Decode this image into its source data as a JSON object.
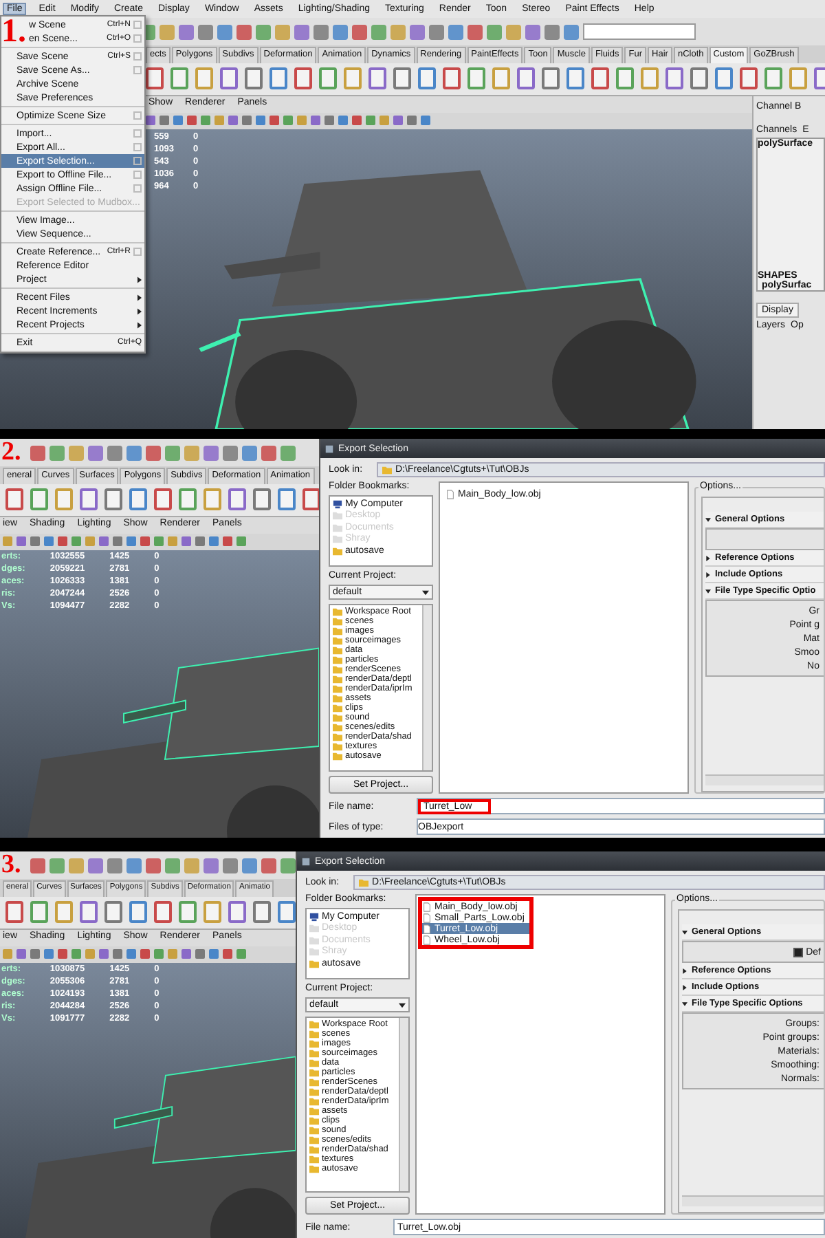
{
  "menu_step": {
    "number": "1.",
    "menubar": [
      {
        "label": "File",
        "selected": true
      },
      {
        "label": "Edit",
        "selected": false
      },
      {
        "label": "Modify",
        "selected": false
      },
      {
        "label": "Create",
        "selected": false
      },
      {
        "label": "Display",
        "selected": false
      },
      {
        "label": "Window",
        "selected": false
      },
      {
        "label": "Assets",
        "selected": false
      },
      {
        "label": "Lighting/Shading",
        "selected": false
      },
      {
        "label": "Texturing",
        "selected": false
      },
      {
        "label": "Render",
        "selected": false
      },
      {
        "label": "Toon",
        "selected": false
      },
      {
        "label": "Stereo",
        "selected": false
      },
      {
        "label": "Paint Effects",
        "selected": false
      },
      {
        "label": "Help",
        "selected": false
      }
    ],
    "shelf_tabs": [
      {
        "label": "ects",
        "selected": false
      },
      {
        "label": "Polygons",
        "selected": false
      },
      {
        "label": "Subdivs",
        "selected": false
      },
      {
        "label": "Deformation",
        "selected": false
      },
      {
        "label": "Animation",
        "selected": false
      },
      {
        "label": "Dynamics",
        "selected": false
      },
      {
        "label": "Rendering",
        "selected": false
      },
      {
        "label": "PaintEffects",
        "selected": false
      },
      {
        "label": "Toon",
        "selected": false
      },
      {
        "label": "Muscle",
        "selected": false
      },
      {
        "label": "Fluids",
        "selected": false
      },
      {
        "label": "Fur",
        "selected": false
      },
      {
        "label": "Hair",
        "selected": false
      },
      {
        "label": "nCloth",
        "selected": false
      },
      {
        "label": "Custom",
        "selected": true
      },
      {
        "label": "GoZBrush",
        "selected": false
      }
    ],
    "panel_menu": [
      "Show",
      "Renderer",
      "Panels"
    ],
    "stats": [
      [
        "559",
        "0"
      ],
      [
        "1093",
        "0"
      ],
      [
        "543",
        "0"
      ],
      [
        "1036",
        "0"
      ],
      [
        "964",
        "0"
      ]
    ],
    "channel_box": {
      "title": "Channel B",
      "tabs": [
        "Channels",
        "E"
      ],
      "object": "polySurface",
      "shapes_heading": "SHAPES",
      "shape": "polySurfac",
      "layer_tabs": [
        {
          "label": "Display",
          "selected": true
        }
      ],
      "layer_menu": [
        "Layers",
        "Op"
      ]
    },
    "file_menu": [
      [
        {
          "label": "w Scene",
          "shortcut": "Ctrl+N",
          "option_box": true,
          "kind": "command",
          "disabled": false,
          "selected": false
        },
        {
          "label": "en Scene...",
          "shortcut": "Ctrl+O",
          "option_box": true,
          "kind": "command",
          "disabled": false,
          "selected": false
        }
      ],
      [
        {
          "label": "Save Scene",
          "shortcut": "Ctrl+S",
          "option_box": true,
          "kind": "command",
          "disabled": false,
          "selected": false
        },
        {
          "label": "Save Scene As...",
          "option_box": true,
          "kind": "command",
          "disabled": false,
          "selected": false
        },
        {
          "label": "Archive Scene",
          "option_box": false,
          "kind": "command",
          "disabled": false,
          "selected": false
        },
        {
          "label": "Save Preferences",
          "option_box": false,
          "kind": "command",
          "disabled": false,
          "selected": false
        }
      ],
      [
        {
          "label": "Optimize Scene Size",
          "option_box": true,
          "kind": "command",
          "disabled": false,
          "selected": false
        }
      ],
      [
        {
          "label": "Import...",
          "option_box": true,
          "kind": "command",
          "disabled": false,
          "selected": false
        },
        {
          "label": "Export All...",
          "option_box": true,
          "kind": "command",
          "disabled": false,
          "selected": false
        },
        {
          "label": "Export Selection...",
          "option_box": true,
          "kind": "command",
          "disabled": false,
          "selected": true
        },
        {
          "label": "Export to Offline File...",
          "option_box": true,
          "kind": "command",
          "disabled": false,
          "selected": false
        },
        {
          "label": "Assign Offline File...",
          "option_box": true,
          "kind": "command",
          "disabled": false,
          "selected": false
        },
        {
          "label": "Export Selected to Mudbox...",
          "option_box": false,
          "kind": "command",
          "disabled": true,
          "selected": false
        }
      ],
      [
        {
          "label": "View Image...",
          "option_box": false,
          "kind": "command",
          "disabled": false,
          "selected": false
        },
        {
          "label": "View Sequence...",
          "option_box": false,
          "kind": "command",
          "disabled": false,
          "selected": false
        }
      ],
      [
        {
          "label": "Create Reference...",
          "shortcut": "Ctrl+R",
          "option_box": true,
          "kind": "command",
          "disabled": false,
          "selected": false
        },
        {
          "label": "Reference Editor",
          "option_box": false,
          "kind": "command",
          "disabled": false,
          "selected": false
        },
        {
          "label": "Project",
          "option_box": false,
          "kind": "submenu",
          "disabled": false,
          "selected": false
        }
      ],
      [
        {
          "label": "Recent Files",
          "option_box": false,
          "kind": "submenu",
          "disabled": false,
          "selected": false
        },
        {
          "label": "Recent Increments",
          "option_box": false,
          "kind": "submenu",
          "disabled": false,
          "selected": false
        },
        {
          "label": "Recent Projects",
          "option_box": false,
          "kind": "submenu",
          "disabled": false,
          "selected": false
        }
      ],
      [
        {
          "label": "Exit",
          "shortcut": "Ctrl+Q",
          "option_box": false,
          "kind": "command",
          "disabled": false,
          "selected": false
        }
      ]
    ]
  },
  "dialog_steps": [
    {
      "number": "2.",
      "shelf_tabs": [
        "eneral",
        "Curves",
        "Surfaces",
        "Polygons",
        "Subdivs",
        "Deformation",
        "Animation"
      ],
      "panel_menu": [
        "iew",
        "Shading",
        "Lighting",
        "Show",
        "Renderer",
        "Panels"
      ],
      "stats": [
        {
          "label": "erts:",
          "values": [
            "1032555",
            "1425",
            "0"
          ]
        },
        {
          "label": "dges:",
          "values": [
            "2059221",
            "2781",
            "0"
          ]
        },
        {
          "label": "aces:",
          "values": [
            "1026333",
            "1381",
            "0"
          ]
        },
        {
          "label": "ris:",
          "values": [
            "2047244",
            "2526",
            "0"
          ]
        },
        {
          "label": "Vs:",
          "values": [
            "1094477",
            "2282",
            "0"
          ]
        }
      ],
      "dialog": {
        "title": "Export Selection",
        "look_in_label": "Look in:",
        "look_in": "D:\\Freelance\\Cgtuts+\\Tut\\OBJs",
        "bookmarks_label": "Folder Bookmarks:",
        "bookmarks": [
          {
            "label": "My Computer",
            "kind": "computer",
            "disabled": false
          },
          {
            "label": "Desktop",
            "kind": "folder",
            "disabled": true
          },
          {
            "label": "Documents",
            "kind": "folder",
            "disabled": true
          },
          {
            "label": "Shray",
            "kind": "folder",
            "disabled": true
          },
          {
            "label": "autosave",
            "kind": "folder",
            "disabled": false
          }
        ],
        "project_label": "Current Project:",
        "project": "default",
        "folders": [
          "Workspace Root",
          "scenes",
          "images",
          "sourceimages",
          "data",
          "particles",
          "renderScenes",
          "renderData/deptl",
          "renderData/iprIm",
          "assets",
          "clips",
          "sound",
          "scenes/edits",
          "renderData/shad",
          "textures",
          "autosave"
        ],
        "set_project": "Set Project...",
        "files": [
          {
            "name": "Main_Body_low.obj",
            "selected": false
          }
        ],
        "file_list_highlighted": false,
        "file_name_highlighted": true,
        "options_label": "Options...",
        "sections": [
          {
            "label": "General Options",
            "expanded": true
          },
          {
            "label": "Reference Options",
            "expanded": false
          },
          {
            "label": "Include Options",
            "expanded": false
          },
          {
            "label": "File Type Specific Optio",
            "expanded": true
          }
        ],
        "file_type_fields": [
          "Gr",
          "Point g",
          "Mat",
          "Smoo",
          "No"
        ],
        "file_name_label": "File name:",
        "file_name": "Turret_Low",
        "file_type_label": "Files of type:",
        "file_type": "OBJexport"
      }
    },
    {
      "number": "3.",
      "shelf_tabs": [
        "eneral",
        "Curves",
        "Surfaces",
        "Polygons",
        "Subdivs",
        "Deformation",
        "Animatio"
      ],
      "panel_menu": [
        "iew",
        "Shading",
        "Lighting",
        "Show",
        "Renderer",
        "Panels"
      ],
      "stats": [
        {
          "label": "erts:",
          "values": [
            "1030875",
            "1425",
            "0"
          ]
        },
        {
          "label": "dges:",
          "values": [
            "2055306",
            "2781",
            "0"
          ]
        },
        {
          "label": "aces:",
          "values": [
            "1024193",
            "1381",
            "0"
          ]
        },
        {
          "label": "ris:",
          "values": [
            "2044284",
            "2526",
            "0"
          ]
        },
        {
          "label": "Vs:",
          "values": [
            "1091777",
            "2282",
            "0"
          ]
        }
      ],
      "dialog": {
        "title": "Export Selection",
        "look_in_label": "Look in:",
        "look_in": "D:\\Freelance\\Cgtuts+\\Tut\\OBJs",
        "bookmarks_label": "Folder Bookmarks:",
        "bookmarks": [
          {
            "label": "My Computer",
            "kind": "computer",
            "disabled": false
          },
          {
            "label": "Desktop",
            "kind": "folder",
            "disabled": true
          },
          {
            "label": "Documents",
            "kind": "folder",
            "disabled": true
          },
          {
            "label": "Shray",
            "kind": "folder",
            "disabled": true
          },
          {
            "label": "autosave",
            "kind": "folder",
            "disabled": false
          }
        ],
        "project_label": "Current Project:",
        "project": "default",
        "folders": [
          "Workspace Root",
          "scenes",
          "images",
          "sourceimages",
          "data",
          "particles",
          "renderScenes",
          "renderData/deptl",
          "renderData/iprIm",
          "assets",
          "clips",
          "sound",
          "scenes/edits",
          "renderData/shad",
          "textures",
          "autosave"
        ],
        "set_project": "Set Project...",
        "files": [
          {
            "name": "Main_Body_low.obj",
            "selected": false
          },
          {
            "name": "Small_Parts_Low.obj",
            "selected": false
          },
          {
            "name": "Turret_Low.obj",
            "selected": true
          },
          {
            "name": "Wheel_Low.obj",
            "selected": false
          }
        ],
        "file_list_highlighted": true,
        "file_name_highlighted": false,
        "options_label": "Options...",
        "sections": [
          {
            "label": "General Options",
            "expanded": true,
            "checkbox": {
              "label": "Def",
              "checked": true
            }
          },
          {
            "label": "Reference Options",
            "expanded": false
          },
          {
            "label": "Include Options",
            "expanded": false
          },
          {
            "label": "File Type Specific Options",
            "expanded": true
          }
        ],
        "file_type_fields": [
          "Groups:",
          "Point groups:",
          "Materials:",
          "Smoothing:",
          "Normals:"
        ],
        "file_name_label": "File name:",
        "file_name": "Turret_Low.obj"
      }
    }
  ]
}
